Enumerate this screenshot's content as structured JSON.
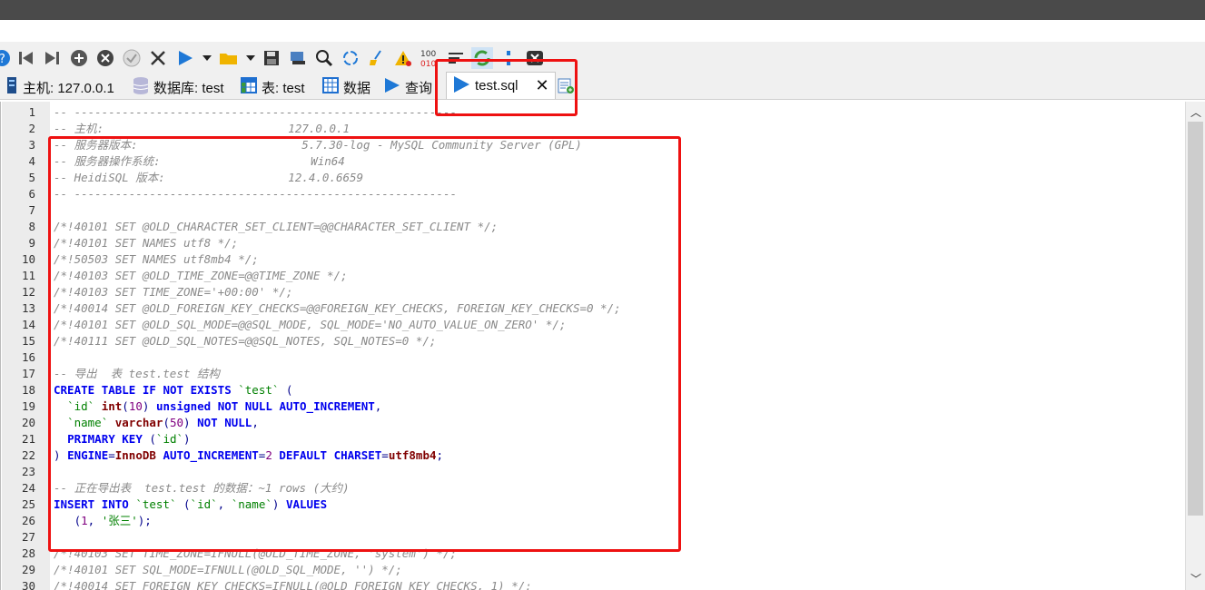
{
  "tabs": [
    {
      "icon": "server-icon",
      "label": "主机: 127.0.0.1"
    },
    {
      "icon": "database-icon",
      "label": "数据库: test"
    },
    {
      "icon": "table-icon",
      "label": "表: test"
    },
    {
      "icon": "data-grid-icon",
      "label": "数据"
    },
    {
      "icon": "query-play-icon",
      "label": "查询"
    },
    {
      "icon": "query-play-icon",
      "label": "test.sql",
      "active": true,
      "close": "✕"
    }
  ],
  "toolbar_icons": [
    "help-icon",
    "first-icon",
    "last-icon",
    "add-icon",
    "delete-icon",
    "ok-icon",
    "cancel-icon",
    "run-icon",
    "run-dropdown-icon",
    "open-folder-icon",
    "open-dropdown-icon",
    "save-icon",
    "save-snippet-icon",
    "find-icon",
    "replace-icon",
    "clear-icon",
    "warning-icon",
    "binary-icon",
    "wrap-icon",
    "refresh-icon",
    "sort-icon",
    "stop-icon"
  ],
  "code_lines": [
    "-- --------------------------------------------------------",
    "-- 主机:                           127.0.0.1",
    "-- 服务器版本:                        5.7.30-log - MySQL Community Server (GPL)",
    "-- 服务器操作系统:                      Win64",
    "-- HeidiSQL 版本:                  12.4.0.6659",
    "-- --------------------------------------------------------",
    "",
    "/*!40101 SET @OLD_CHARACTER_SET_CLIENT=@@CHARACTER_SET_CLIENT */;",
    "/*!40101 SET NAMES utf8 */;",
    "/*!50503 SET NAMES utf8mb4 */;",
    "/*!40103 SET @OLD_TIME_ZONE=@@TIME_ZONE */;",
    "/*!40103 SET TIME_ZONE='+00:00' */;",
    "/*!40014 SET @OLD_FOREIGN_KEY_CHECKS=@@FOREIGN_KEY_CHECKS, FOREIGN_KEY_CHECKS=0 */;",
    "/*!40101 SET @OLD_SQL_MODE=@@SQL_MODE, SQL_MODE='NO_AUTO_VALUE_ON_ZERO' */;",
    "/*!40111 SET @OLD_SQL_NOTES=@@SQL_NOTES, SQL_NOTES=0 */;",
    "",
    "-- 导出  表 test.test 结构",
    "CREATE TABLE IF NOT EXISTS `test` (",
    "  `id` int(10) unsigned NOT NULL AUTO_INCREMENT,",
    "  `name` varchar(50) NOT NULL,",
    "  PRIMARY KEY (`id`)",
    ") ENGINE=InnoDB AUTO_INCREMENT=2 DEFAULT CHARSET=utf8mb4;",
    "",
    "-- 正在导出表  test.test 的数据：~1 rows (大约)",
    "INSERT INTO `test` (`id`, `name`) VALUES",
    "   (1, '张三');",
    "",
    "/*!40103 SET TIME_ZONE=IFNULL(@OLD_TIME_ZONE, 'system') */;",
    "/*!40101 SET SQL_MODE=IFNULL(@OLD_SQL_MODE, '') */;",
    "/*!40014 SET FOREIGN_KEY_CHECKS=IFNULL(@OLD_FOREIGN_KEY_CHECKS, 1) */;"
  ],
  "colors": {
    "highlight_box": "#ee1111",
    "keyword": "#0000ee",
    "type": "#800000",
    "comment": "#8a8a8a",
    "string": "#008000"
  }
}
